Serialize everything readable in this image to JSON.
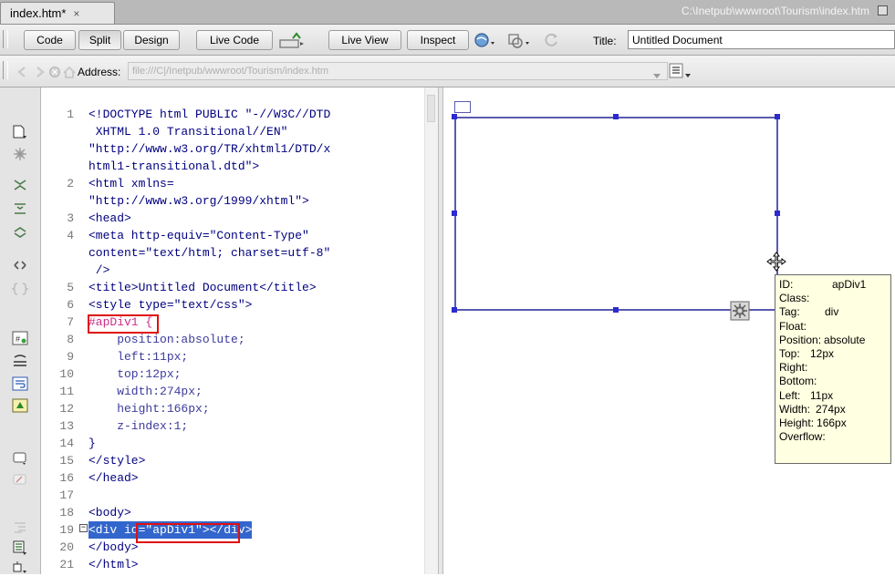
{
  "tabbar": {
    "tab_label": "index.htm*",
    "close_glyph": "×",
    "file_path": "C:\\Inetpub\\wwwroot\\Tourism\\index.htm"
  },
  "toolbar": {
    "code_label": "Code",
    "split_label": "Split",
    "design_label": "Design",
    "live_code_label": "Live Code",
    "live_view_label": "Live View",
    "inspect_label": "Inspect",
    "title_label": "Title:",
    "title_value": "Untitled Document"
  },
  "address": {
    "label": "Address:",
    "value": "file:///C|/Inetpub/wwwroot/Tourism/index.htm"
  },
  "code_lines": [
    {
      "n": "1",
      "text": "<!DOCTYPE html PUBLIC \"-//W3C//DTD"
    },
    {
      "n": "",
      "text": " XHTML 1.0 Transitional//EN\""
    },
    {
      "n": "",
      "text": "\"http://www.w3.org/TR/xhtml1/DTD/x"
    },
    {
      "n": "",
      "text": "html1-transitional.dtd\">"
    },
    {
      "n": "2",
      "text": "<html xmlns="
    },
    {
      "n": "",
      "text": "\"http://www.w3.org/1999/xhtml\">"
    },
    {
      "n": "3",
      "text": "<head>"
    },
    {
      "n": "4",
      "text": "<meta http-equiv=\"Content-Type\""
    },
    {
      "n": "",
      "text": "content=\"text/html; charset=utf-8\""
    },
    {
      "n": "",
      "text": " />"
    },
    {
      "n": "5",
      "text": "<title>Untitled Document</title>"
    },
    {
      "n": "6",
      "text": "<style type=\"text/css\">"
    },
    {
      "n": "7",
      "text": "#apDiv1 {"
    },
    {
      "n": "8",
      "text": "    position:absolute;"
    },
    {
      "n": "9",
      "text": "    left:11px;"
    },
    {
      "n": "10",
      "text": "    top:12px;"
    },
    {
      "n": "11",
      "text": "    width:274px;"
    },
    {
      "n": "12",
      "text": "    height:166px;"
    },
    {
      "n": "13",
      "text": "    z-index:1;"
    },
    {
      "n": "14",
      "text": "}"
    },
    {
      "n": "15",
      "text": "</style>"
    },
    {
      "n": "16",
      "text": "</head>"
    },
    {
      "n": "17",
      "text": ""
    },
    {
      "n": "18",
      "text": "<body>"
    },
    {
      "n": "19",
      "text": "<div id=\"apDiv1\"></div>"
    },
    {
      "n": "20",
      "text": "</body>"
    },
    {
      "n": "21",
      "text": "</html>"
    }
  ],
  "tooltip": {
    "rows": [
      {
        "key": "ID:",
        "val": "apDiv1"
      },
      {
        "key": "Class:",
        "val": ""
      },
      {
        "key": "Tag:",
        "val": "div"
      },
      {
        "key": "Float:",
        "val": ""
      },
      {
        "key": "Position:",
        "val": "absolute"
      },
      {
        "key": "Top:",
        "val": "12px"
      },
      {
        "key": "Right:",
        "val": ""
      },
      {
        "key": "Bottom:",
        "val": ""
      },
      {
        "key": "Left:",
        "val": "11px"
      },
      {
        "key": "Width:",
        "val": "274px"
      },
      {
        "key": "Height:",
        "val": "166px"
      },
      {
        "key": "Overflow:",
        "val": ""
      }
    ]
  },
  "colors": {
    "selection": "#3366cc",
    "highlight_box": "#e01010",
    "ap_div_border": "#5a5ab0",
    "tooltip_bg": "#ffffe1"
  },
  "icons": [
    "refresh-icon",
    "browser-preview-icon",
    "inspect-icon",
    "file-management-icon",
    "visual-aids-icon",
    "move-cursor-icon",
    "ap-element-anchor-icon"
  ]
}
